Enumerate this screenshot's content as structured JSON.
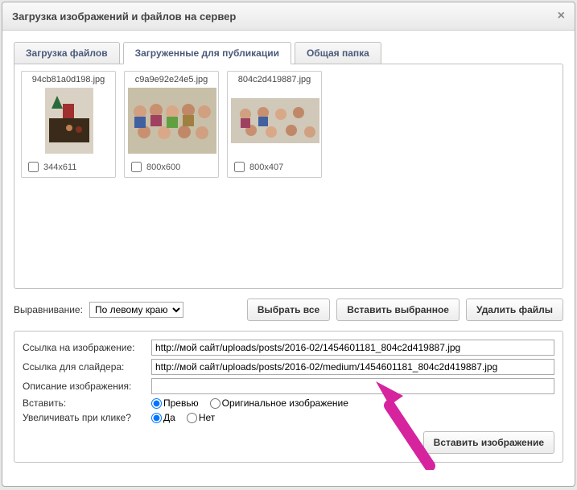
{
  "dialog": {
    "title": "Загрузка изображений и файлов на сервер",
    "close": "×"
  },
  "tabs": {
    "upload": "Загрузка файлов",
    "published": "Загруженные для публикации",
    "shared": "Общая папка"
  },
  "thumbnails": [
    {
      "filename": "94cb81a0d198.jpg",
      "dims": "344x611"
    },
    {
      "filename": "c9a9e92e24e5.jpg",
      "dims": "800x600"
    },
    {
      "filename": "804c2d419887.jpg",
      "dims": "800x407"
    }
  ],
  "align": {
    "label": "Выравнивание:",
    "value": "По левому краю"
  },
  "buttons": {
    "select_all": "Выбрать все",
    "insert_selected": "Вставить выбранное",
    "delete_files": "Удалить файлы",
    "insert_image": "Вставить изображение"
  },
  "form": {
    "image_link_label": "Ссылка на изображение:",
    "image_link_value": "http://мой сайт/uploads/posts/2016-02/1454601181_804c2d419887.jpg",
    "slider_link_label": "Ссылка для слайдера:",
    "slider_link_value": "http://мой сайт/uploads/posts/2016-02/medium/1454601181_804c2d419887.jpg",
    "description_label": "Описание изображения:",
    "description_value": "",
    "insert_label": "Вставить:",
    "preview_label": "Превью",
    "original_label": "Оригинальное изображение",
    "enlarge_label": "Увеличивать при клике?",
    "yes_label": "Да",
    "no_label": "Нет"
  }
}
